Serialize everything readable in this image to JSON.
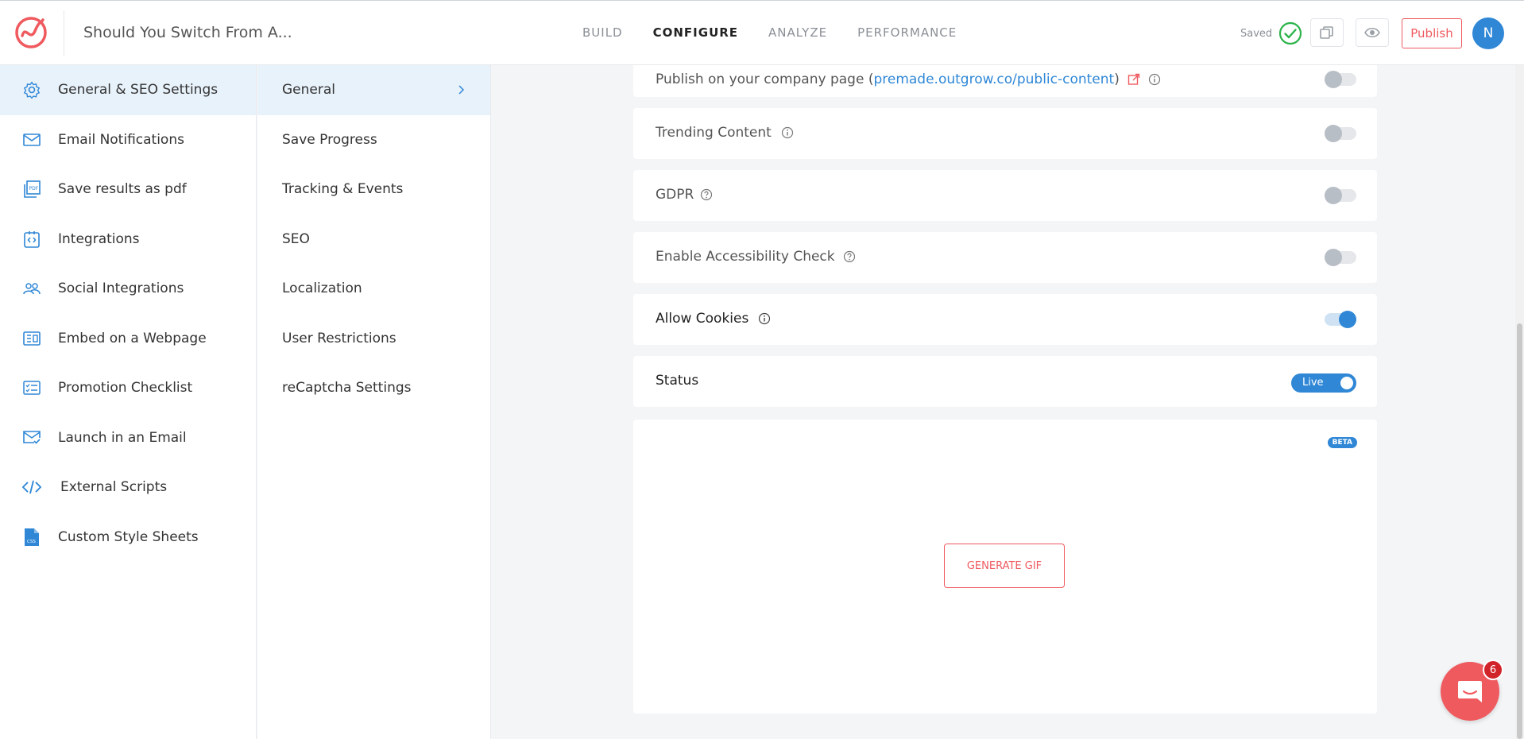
{
  "header": {
    "project_title": "Should You Switch From A...",
    "tabs": [
      {
        "label": "BUILD"
      },
      {
        "label": "CONFIGURE"
      },
      {
        "label": "ANALYZE"
      },
      {
        "label": "PERFORMANCE"
      }
    ],
    "active_tab": "CONFIGURE",
    "saved_label": "Saved",
    "publish_label": "Publish",
    "avatar_initial": "N"
  },
  "sidebar": {
    "items": [
      {
        "label": "General & SEO Settings",
        "icon": "gear-icon"
      },
      {
        "label": "Email Notifications",
        "icon": "envelope-icon"
      },
      {
        "label": "Save results as pdf",
        "icon": "pdf-icon"
      },
      {
        "label": "Integrations",
        "icon": "integrations-icon"
      },
      {
        "label": "Social Integrations",
        "icon": "users-icon"
      },
      {
        "label": "Embed on a Webpage",
        "icon": "embed-icon"
      },
      {
        "label": "Promotion Checklist",
        "icon": "checklist-icon"
      },
      {
        "label": "Launch in an Email",
        "icon": "email-launch-icon"
      },
      {
        "label": "External Scripts",
        "icon": "code-icon"
      },
      {
        "label": "Custom Style Sheets",
        "icon": "css-file-icon"
      }
    ],
    "active_index": 0
  },
  "subnav": {
    "items": [
      {
        "label": "General"
      },
      {
        "label": "Save Progress"
      },
      {
        "label": "Tracking & Events"
      },
      {
        "label": "SEO"
      },
      {
        "label": "Localization"
      },
      {
        "label": "User Restrictions"
      },
      {
        "label": "reCaptcha Settings"
      }
    ],
    "active_index": 0
  },
  "settings": {
    "publish_company": {
      "label_prefix": "Publish on your company page (",
      "link_text": "premade.outgrow.co/public-content",
      "label_suffix": ")",
      "enabled": false
    },
    "trending_content": {
      "label": "Trending Content",
      "enabled": false
    },
    "gdpr": {
      "label": "GDPR",
      "enabled": false
    },
    "accessibility": {
      "label": "Enable Accessibility Check",
      "enabled": false
    },
    "allow_cookies": {
      "label": "Allow Cookies",
      "enabled": true
    },
    "status": {
      "label": "Status",
      "value": "Live"
    }
  },
  "gif": {
    "beta_label": "BETA",
    "button_label": "GENERATE GIF"
  },
  "chat": {
    "badge_count": "6"
  },
  "colors": {
    "accent_red": "#ef5a5f",
    "accent_blue": "#2f87d6",
    "active_bg": "#e8f2fb",
    "saved_green": "#2cb34a"
  }
}
